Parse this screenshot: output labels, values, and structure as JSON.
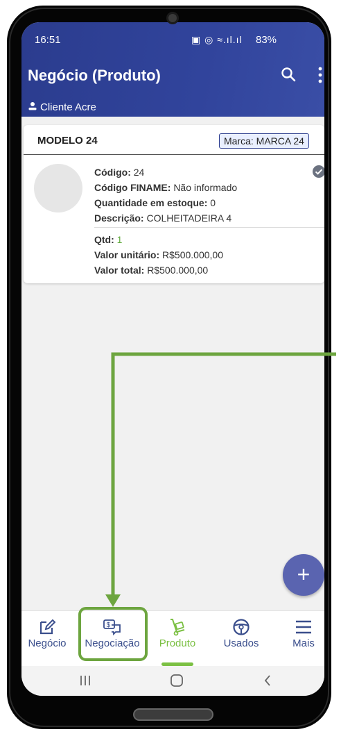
{
  "status_bar": {
    "time": "16:51",
    "icons": "▣ ◎ ≈.ıl.ıl",
    "battery": "83%"
  },
  "appbar": {
    "title": "Negócio (Produto)",
    "client": "Cliente Acre"
  },
  "card": {
    "model": "MODELO 24",
    "brand": "Marca: MARCA 24",
    "codigo_label": "Código:",
    "codigo_value": "24",
    "finame_label": "Código FINAME:",
    "finame_value": "Não informado",
    "estoque_label": "Quantidade em estoque:",
    "estoque_value": "0",
    "descricao_label": "Descrição:",
    "descricao_value": "COLHEITADEIRA 4",
    "qtd_label": "Qtd:",
    "qtd_value": "1",
    "unitario_label": "Valor unitário:",
    "unitario_value": "R$500.000,00",
    "total_label": "Valor total:",
    "total_value": "R$500.000,00"
  },
  "fab": {
    "label": "+"
  },
  "bottom_nav": {
    "items": [
      {
        "label": "Negócio",
        "icon": "edit-icon"
      },
      {
        "label": "Negociação",
        "icon": "money-chat-icon"
      },
      {
        "label": "Produto",
        "icon": "hand-truck-icon",
        "active": true
      },
      {
        "label": "Usados",
        "icon": "steering-wheel-icon"
      },
      {
        "label": "Mais",
        "icon": "menu-icon"
      }
    ]
  },
  "colors": {
    "appbar": "#2b3c8e",
    "accent_green": "#7bc043",
    "fab": "#5a64b0",
    "annotation": "#6da53f"
  }
}
